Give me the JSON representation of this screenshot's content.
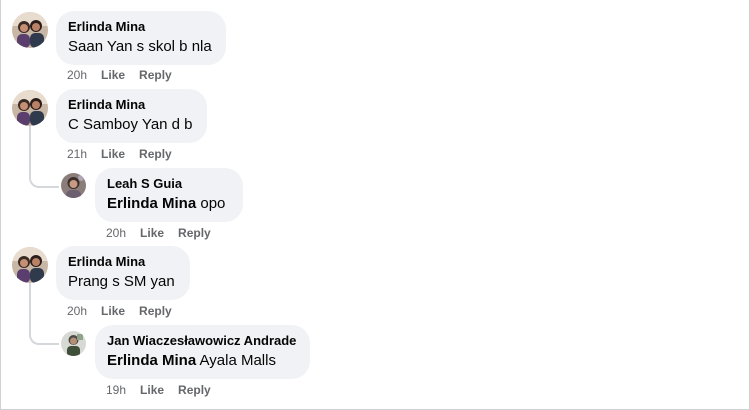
{
  "comments": [
    {
      "author": "Erlinda Mina",
      "text": "Saan Yan s skol b nla",
      "time": "20h",
      "like": "Like",
      "reply": "Reply"
    },
    {
      "author": "Erlinda Mina",
      "text": "C Samboy Yan d b",
      "time": "21h",
      "like": "Like",
      "reply": "Reply",
      "replies": [
        {
          "author": "Leah S Guia",
          "mention": "Erlinda Mina",
          "text": "opo",
          "time": "20h",
          "like": "Like",
          "reply": "Reply"
        }
      ]
    },
    {
      "author": "Erlinda Mina",
      "text": "Prang s SM yan",
      "time": "20h",
      "like": "Like",
      "reply": "Reply",
      "replies": [
        {
          "author": "Jan Wiaczesławowicz Andrade",
          "mention": "Erlinda Mina",
          "text": "Ayala Malls",
          "time": "19h",
          "like": "Like",
          "reply": "Reply"
        }
      ]
    }
  ],
  "colors": {
    "bubble": "#f0f2f5",
    "meta_text": "#65676b",
    "thread_line": "#d4d7dc"
  },
  "icons": {
    "erlinda_avatar": "erlinda-avatar",
    "leah_avatar": "leah-avatar",
    "jan_avatar": "jan-avatar"
  }
}
